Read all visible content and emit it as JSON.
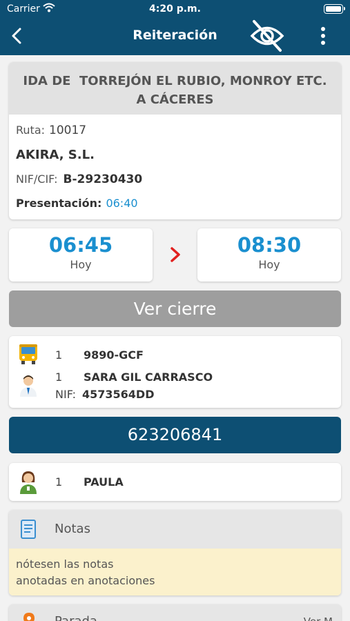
{
  "status_bar": {
    "carrier": "Carrier",
    "time": "4:20 p.m."
  },
  "header": {
    "title": "Reiteración",
    "back_icon": "chevron-left-icon",
    "visibility_icon": "eye-off-icon",
    "menu_icon": "more-vertical-icon"
  },
  "route": {
    "title_line1": "IDA DE  TORREJÓN EL RUBIO, MONROY ETC.",
    "title_line2": "A CÁCERES",
    "ruta_label": "Ruta:",
    "ruta_value": "10017",
    "company": "AKIRA, S.L.",
    "nif_label": "NIF/CIF:",
    "nif_value": "B-29230430",
    "presentacion_label": "Presentación:",
    "presentacion_value": "06:40"
  },
  "times": {
    "start_time": "06:45",
    "start_day": "Hoy",
    "end_time": "08:30",
    "end_day": "Hoy"
  },
  "ver_cierre_label": "Ver cierre",
  "vehicle": {
    "bus_count": "1",
    "plate": "9890-GCF",
    "driver_count": "1",
    "driver_name": "SARA GIL CARRASCO",
    "driver_nif_label": "NIF:",
    "driver_nif": "4573564DD"
  },
  "phone_number": "623206841",
  "guide": {
    "count": "1",
    "name": "PAULA"
  },
  "notes": {
    "title": "Notas",
    "line1": "nótesen las notas",
    "line2": "anotadas en anotaciones"
  },
  "next_section": {
    "title": "Parada",
    "action": "Ver M"
  },
  "colors": {
    "header": "#0d4f73",
    "accent_blue": "#1a8fcf",
    "accent_red": "#e1201f",
    "notes_bg": "#fbf1cc"
  }
}
